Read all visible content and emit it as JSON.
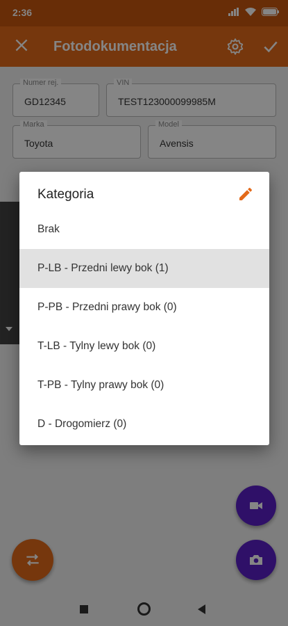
{
  "status": {
    "time": "2:36"
  },
  "appbar": {
    "title": "Fotodokumentacja"
  },
  "form": {
    "numer_rej": {
      "label": "Numer rej.",
      "value": "GD12345"
    },
    "vin": {
      "label": "VIN",
      "value": "TEST123000099985M"
    },
    "marka": {
      "label": "Marka",
      "value": "Toyota"
    },
    "model": {
      "label": "Model",
      "value": "Avensis"
    }
  },
  "dialog": {
    "title": "Kategoria",
    "options": [
      {
        "label": "Brak",
        "selected": false
      },
      {
        "label": "P-LB - Przedni lewy bok (1)",
        "selected": true
      },
      {
        "label": "P-PB - Przedni prawy bok (0)",
        "selected": false
      },
      {
        "label": "T-LB - Tylny lewy bok (0)",
        "selected": false
      },
      {
        "label": "T-PB - Tylny prawy bok (0)",
        "selected": false
      },
      {
        "label": "D - Drogomierz (0)",
        "selected": false
      }
    ]
  },
  "colors": {
    "primary": "#e36a1a",
    "primary_dark": "#c7560f",
    "accent": "#5a20c8",
    "edit_icon": "#e36a1a"
  },
  "icons": [
    "close-icon",
    "gear-icon",
    "check-icon",
    "edit-icon",
    "swap-icon",
    "videocam-icon",
    "camera-icon"
  ]
}
